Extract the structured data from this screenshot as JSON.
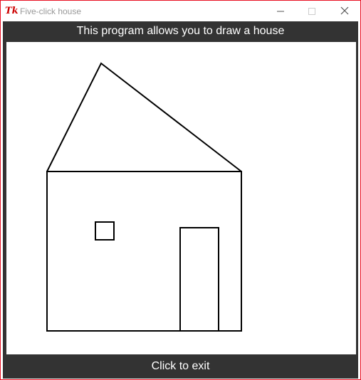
{
  "window": {
    "title": "Five-click house",
    "icon": "tk-feather-icon",
    "border_color": "#e81123"
  },
  "controls": {
    "minimize_icon": "minimize-icon",
    "maximize_icon": "maximize-icon",
    "close_icon": "close-icon"
  },
  "app": {
    "instruction": "This program allows you to draw a house",
    "exit_prompt": "Click to exit",
    "panel_color": "#333333",
    "canvas_color": "#ffffff",
    "stroke_color": "#000000"
  }
}
